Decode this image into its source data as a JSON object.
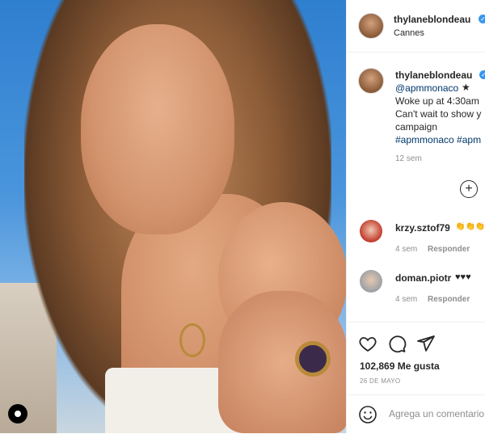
{
  "post": {
    "username": "thylaneblondeau",
    "location": "Cannes"
  },
  "caption": {
    "username": "thylaneblondeau",
    "line1": "@apmmonaco",
    "line2": "Woke up at 4:30am",
    "line3": "Can't wait to show y",
    "line4": "campaign",
    "line5": "#apmmonaco #apm",
    "time": "12 sem"
  },
  "comments": [
    {
      "username": "krzy.sztof79",
      "text": "👏👏👏",
      "time": "4 sem",
      "reply": "Responder"
    },
    {
      "username": "doman.piotr",
      "text": "♥♥♥",
      "time": "4 sem",
      "reply": "Responder"
    }
  ],
  "likes": "102,869 Me gusta",
  "date": "26 DE MAYO",
  "comment_placeholder": "Agrega un comentario",
  "icons": [
    "heart-icon",
    "comment-icon",
    "share-icon",
    "add-icon",
    "smile-icon",
    "verified-badge-icon"
  ],
  "colors": {
    "link": "#00376b",
    "verified": "#3897f0",
    "muted": "#8e8e8e"
  }
}
